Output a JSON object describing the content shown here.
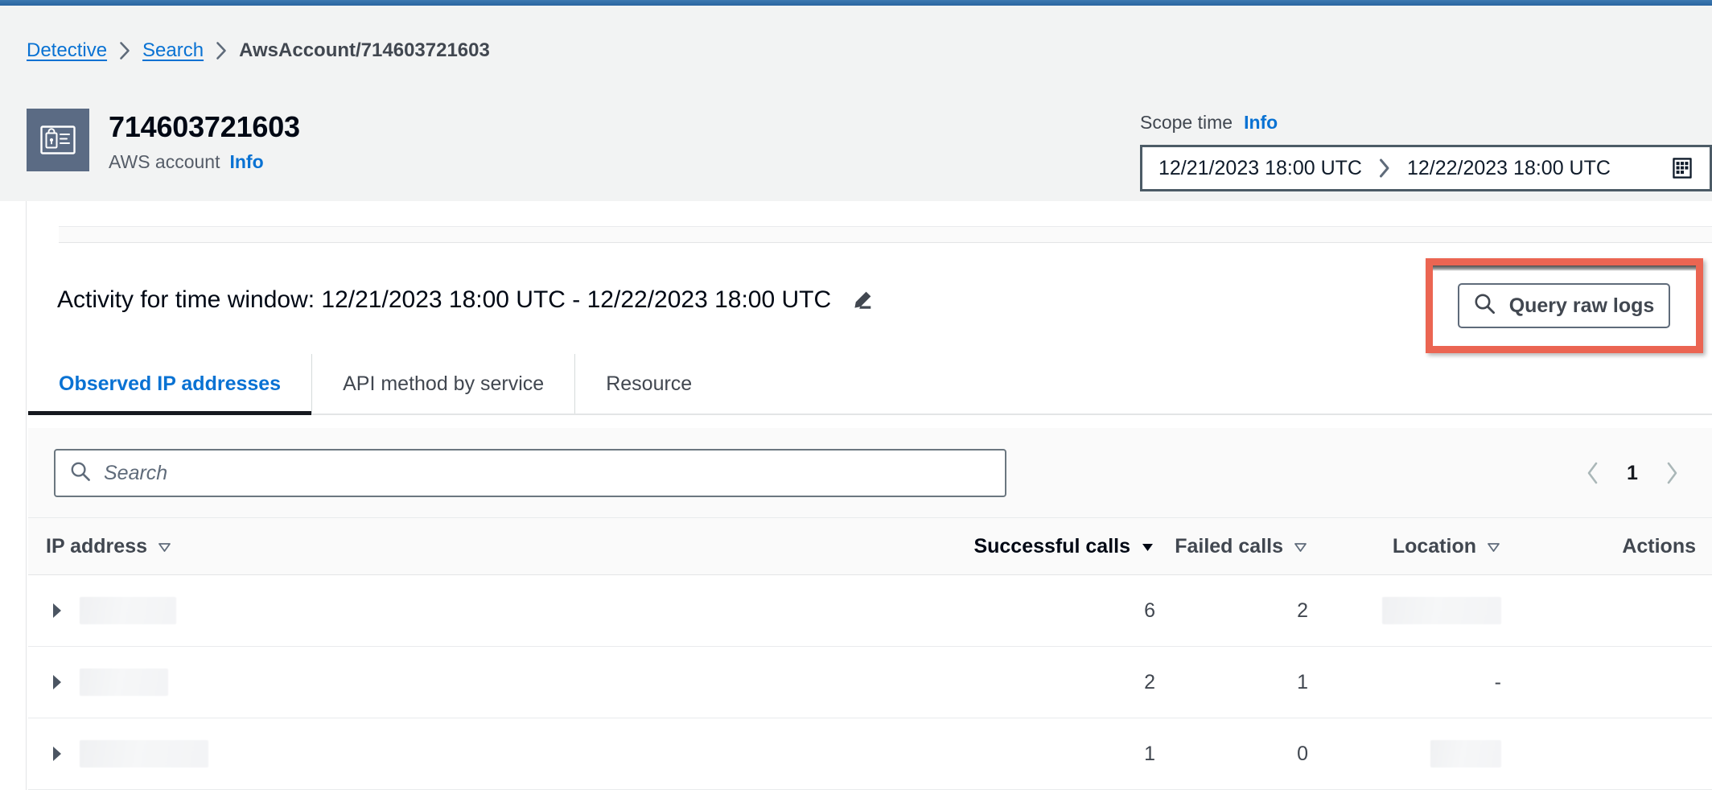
{
  "breadcrumb": {
    "items": [
      {
        "label": "Detective",
        "type": "link"
      },
      {
        "label": "Search",
        "type": "link"
      },
      {
        "label": "AwsAccount/714603721603",
        "type": "current"
      }
    ]
  },
  "entity": {
    "icon": "aws-account-badge-icon",
    "title": "714603721603",
    "subtitle": "AWS account",
    "info_label": "Info"
  },
  "scope_time": {
    "label": "Scope time",
    "info_label": "Info",
    "start": "12/21/2023 18:00 UTC",
    "end": "12/22/2023 18:00 UTC",
    "range_separator": "›",
    "calendar_icon": "calendar-icon"
  },
  "activity": {
    "title": "Activity for time window: 12/21/2023 18:00 UTC - 12/22/2023 18:00 UTC",
    "edit_icon": "pencil-edit-icon",
    "query_button": {
      "label": "Query raw logs",
      "icon": "search-icon",
      "highlighted": true,
      "highlight_color": "#eb6552"
    }
  },
  "tabs": [
    {
      "label": "Observed IP addresses",
      "active": true
    },
    {
      "label": "API method by service",
      "active": false
    },
    {
      "label": "Resource",
      "active": false
    }
  ],
  "toolbar": {
    "search": {
      "placeholder": "Search",
      "value": "",
      "icon": "search-icon"
    },
    "pagination": {
      "previous_icon": "chevron-left-icon",
      "next_icon": "chevron-right-icon",
      "current_page": "1"
    }
  },
  "table": {
    "columns": [
      {
        "label": "IP address",
        "sorted": false,
        "sort_state": "none"
      },
      {
        "label": "Successful calls",
        "sorted": true,
        "sort_state": "descending"
      },
      {
        "label": "Failed calls",
        "sorted": false,
        "sort_state": "none"
      },
      {
        "label": "Location",
        "sorted": false,
        "sort_state": "none"
      },
      {
        "label": "Actions",
        "sorted": false,
        "sort_state": "none"
      }
    ],
    "rows": [
      {
        "expand_icon": "caret-right-icon",
        "ip_address": "",
        "ip_redacted": true,
        "ip_redacted_width": 120,
        "successful_calls": "6",
        "failed_calls": "2",
        "location": "",
        "location_redacted": true,
        "location_redacted_width": 148,
        "actions": ""
      },
      {
        "expand_icon": "caret-right-icon",
        "ip_address": "",
        "ip_redacted": true,
        "ip_redacted_width": 110,
        "successful_calls": "2",
        "failed_calls": "1",
        "location": "-",
        "location_redacted": false,
        "location_redacted_width": 0,
        "actions": ""
      },
      {
        "expand_icon": "caret-right-icon",
        "ip_address": "",
        "ip_redacted": true,
        "ip_redacted_width": 160,
        "successful_calls": "1",
        "failed_calls": "0",
        "location": "",
        "location_redacted": true,
        "location_redacted_width": 88,
        "actions": ""
      }
    ]
  },
  "colors": {
    "accent_blue": "#0972d3",
    "top_bar": "#2e6da4",
    "highlight_red": "#eb6552",
    "header_bg": "#f2f3f3",
    "entity_icon_bg": "#5b6b84"
  }
}
